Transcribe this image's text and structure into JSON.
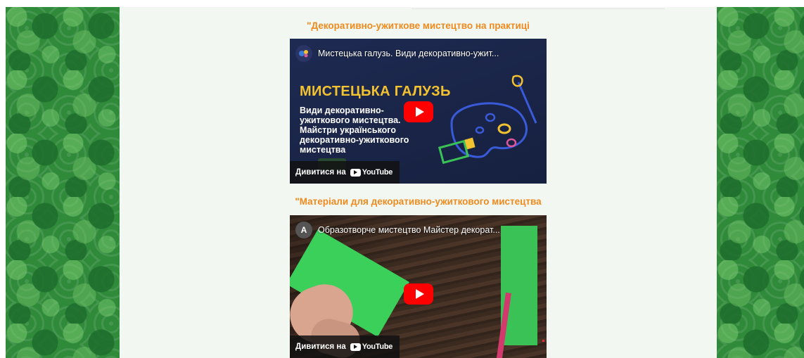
{
  "sections": [
    {
      "heading": "\"Декоративно-ужиткове мистецтво на практиці",
      "video": {
        "title": "Мистецька галузь. Види декоративно-ужит...",
        "channel_icon": "channel-logo-icon",
        "thumb_heading": "МИСТЕЦЬКА ГАЛУЗЬ",
        "thumb_subtitle": "Види декоративно-ужиткового мистецтва. Майстри українського декоративно-ужиткового мистецтва",
        "watch_label": "Дивитися на",
        "platform": "YouTube"
      }
    },
    {
      "heading": "\"Матеріали для декоративно-ужиткового мистецтва",
      "video": {
        "title": "Образотворче мистецтво Майстер декорат...",
        "channel_initial": "А",
        "watch_label": "Дивитися на",
        "platform": "YouTube"
      }
    }
  ],
  "colors": {
    "heading": "#f08a1c",
    "side_pattern": "#2f8a3a",
    "content_bg": "#f2f7f2",
    "play_button": "#ff0000"
  }
}
